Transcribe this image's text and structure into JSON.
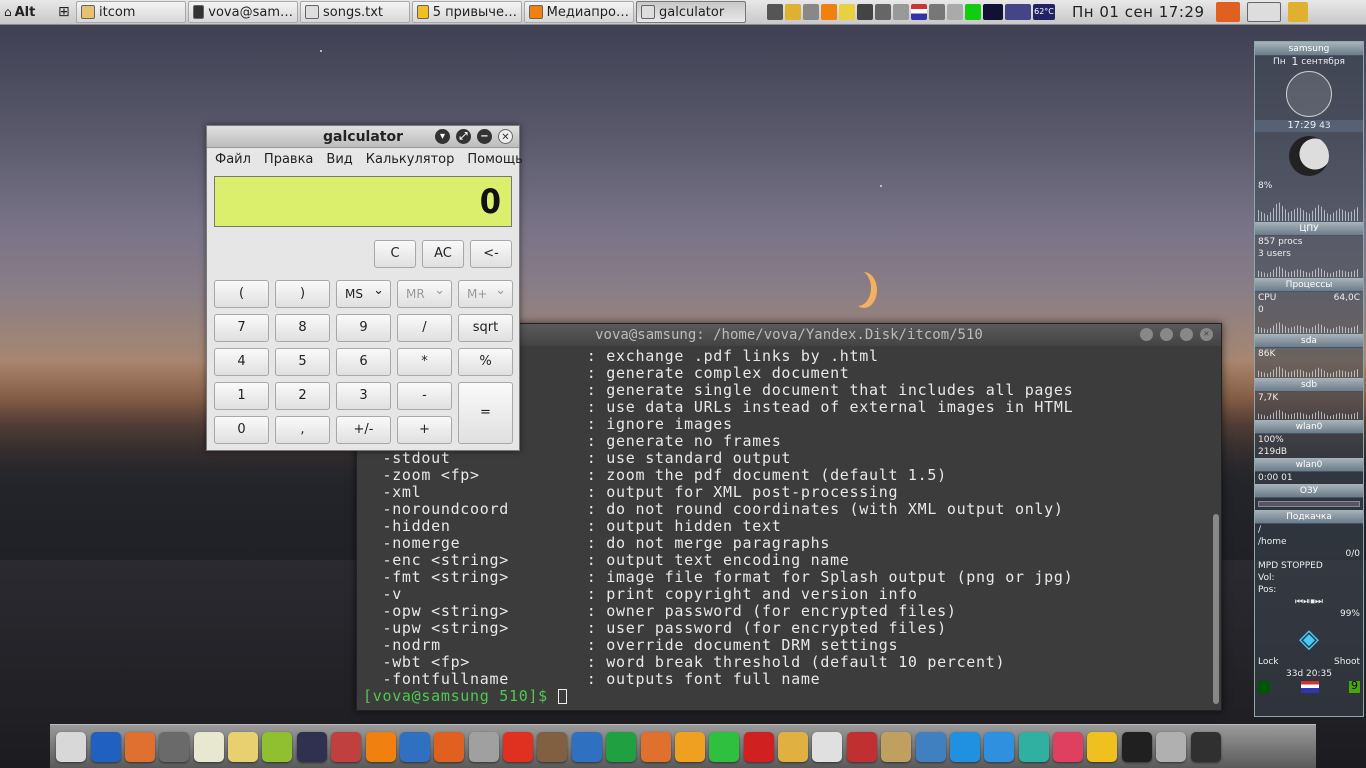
{
  "top_panel": {
    "menu_label": "Alt",
    "tasks": [
      {
        "label": "itcom",
        "icon": "folder-icon"
      },
      {
        "label": "vova@sam…",
        "icon": "terminal-icon"
      },
      {
        "label": "songs.txt",
        "icon": "text-editor-icon"
      },
      {
        "label": "5 привыче…",
        "icon": "browser-icon"
      },
      {
        "label": "Медиапро…",
        "icon": "vlc-icon"
      },
      {
        "label": "galculator",
        "icon": "calculator-icon",
        "active": true
      }
    ],
    "temperature": "62°C",
    "clock": "Пн 01 сен 17:29"
  },
  "galculator": {
    "title": "galculator",
    "menu": [
      "Файл",
      "Правка",
      "Вид",
      "Калькулятор",
      "Помощь"
    ],
    "display": "0",
    "buttons": {
      "c": "C",
      "ac": "AC",
      "back": "<-",
      "lparen": "(",
      "rparen": ")",
      "ms": "MS",
      "mr": "MR",
      "mplus": "M+",
      "n7": "7",
      "n8": "8",
      "n9": "9",
      "div": "/",
      "sqrt": "sqrt",
      "n4": "4",
      "n5": "5",
      "n6": "6",
      "mul": "*",
      "pct": "%",
      "n1": "1",
      "n2": "2",
      "n3": "3",
      "minus": "-",
      "eq": "=",
      "n0": "0",
      "dot": ",",
      "sign": "+/-",
      "plus": "+"
    }
  },
  "terminal": {
    "title": "vova@samsung: /home/vova/Yandex.Disk/itcom/510",
    "lines": [
      "                       : exchange .pdf links by .html",
      "                       : generate complex document",
      "                       : generate single document that includes all pages",
      "                       : use data URLs instead of external images in HTML",
      "                       : ignore images",
      "                       : generate no frames",
      "  -stdout              : use standard output",
      "  -zoom <fp>           : zoom the pdf document (default 1.5)",
      "  -xml                 : output for XML post-processing",
      "  -noroundcoord        : do not round coordinates (with XML output only)",
      "  -hidden              : output hidden text",
      "  -nomerge             : do not merge paragraphs",
      "  -enc <string>        : output text encoding name",
      "  -fmt <string>        : image file format for Splash output (png or jpg)",
      "  -v                   : print copyright and version info",
      "  -opw <string>        : owner password (for encrypted files)",
      "  -upw <string>        : user password (for encrypted files)",
      "  -nodrm               : override document DRM settings",
      "  -wbt <fp>            : word break threshold (default 10 percent)",
      "  -fontfullname        : outputs font full name"
    ],
    "prompt": "[vova@samsung 510]$ "
  },
  "conky": {
    "host": "samsung",
    "date_day": "Пн",
    "date_num": "1",
    "date_month": "сентября",
    "time": "17:29",
    "time_sec": "43",
    "cpu_percent": "8%",
    "cpu_label": "ЦПУ",
    "procs": "857",
    "procs_label": "procs",
    "users": "3",
    "users_label": "users",
    "processes_label": "Процессы",
    "cpu_temp_label": "CPU",
    "cpu_temp": "64,0C",
    "sda_val": "0",
    "sda_label": "sda",
    "sdb_val": "86K",
    "sdb_label": "sdb",
    "wlan_val": "7,7K",
    "wlan_label": "wlan0",
    "wlan_quality": "100%",
    "wlan_db": "219",
    "wlan_db_unit": "dB",
    "wlan_label2": "wlan0",
    "wlan_time": "0:00",
    "wlan_time_sec": "01",
    "ram_label": "ОЗУ",
    "mounts_label": "Подкачка",
    "mount_root": "/",
    "mount_home": "/home",
    "swap_val": "0/0",
    "mpd_status": "MPD STOPPED",
    "vol_label": "Vol:",
    "pos_label": "Pos:",
    "battery": "99%",
    "lock_label": "Lock",
    "shoot_label": "Shoot",
    "uptime": "33d 20:35",
    "workspace": "9"
  },
  "dock": {
    "icons": [
      "dock-app-icon",
      "dock-scratch-icon",
      "dock-paint-icon",
      "dock-calculator-icon",
      "dock-notes-icon",
      "dock-mail-icon",
      "dock-pen-icon",
      "dock-video-icon",
      "dock-backup-icon",
      "dock-vlc-icon",
      "dock-kde-icon",
      "dock-firefox-icon",
      "dock-speaker-icon",
      "dock-djvu-icon",
      "dock-photo-icon",
      "dock-writer-icon",
      "dock-calc-icon",
      "dock-impress-icon",
      "dock-draw-icon",
      "dock-whatsapp-icon",
      "dock-pencil-icon",
      "dock-reader-icon",
      "dock-stocks-icon",
      "dock-tablet-icon",
      "dock-dictionary-icon",
      "dock-gimp-icon",
      "dock-telegram-icon",
      "dock-chat1-icon",
      "dock-chat2-icon",
      "dock-chat3-icon",
      "dock-chat4-icon",
      "dock-settings-icon",
      "dock-files-icon",
      "dock-terminal-icon"
    ],
    "colors": [
      "#d8d8d8",
      "#2060c0",
      "#e07030",
      "#6a6a6a",
      "#e8e8d0",
      "#e8d070",
      "#90c030",
      "#303050",
      "#c04040",
      "#f08010",
      "#3070c0",
      "#e06020",
      "#a0a0a0",
      "#e03020",
      "#806040",
      "#3070c0",
      "#20a040",
      "#e07030",
      "#f0a020",
      "#30c040",
      "#d02020",
      "#e0b040",
      "#e0e0e0",
      "#c03030",
      "#c0a060",
      "#4080c0",
      "#2090e0",
      "#3090e0",
      "#30b0a0",
      "#e04060",
      "#f0c020",
      "#202020",
      "#b0b0b0",
      "#303030"
    ]
  }
}
